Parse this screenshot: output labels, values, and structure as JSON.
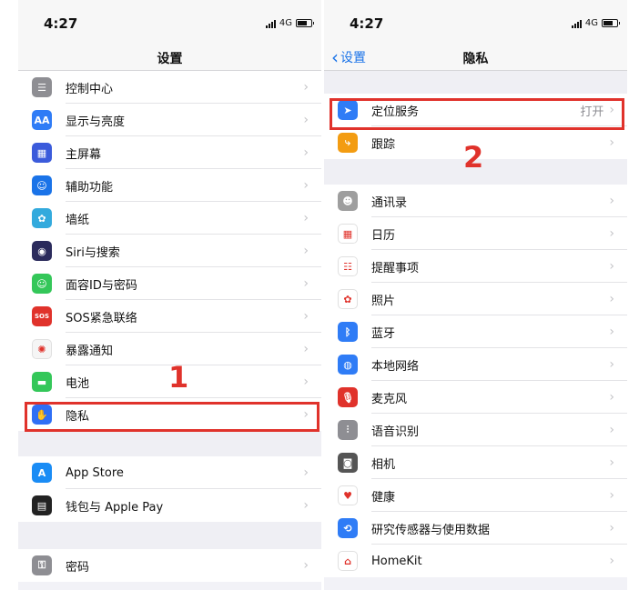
{
  "left": {
    "time": "4:27",
    "network": "4G",
    "title": "设置",
    "group1": [
      {
        "label": "控制中心",
        "icon": "switches-icon",
        "color": "#8e8e93",
        "glyph": "☰"
      },
      {
        "label": "显示与亮度",
        "icon": "display-aa-icon",
        "color": "#2f7cf6",
        "glyph": "AA"
      },
      {
        "label": "主屏幕",
        "icon": "home-screen-icon",
        "color": "#3b5bdb",
        "glyph": "▦"
      },
      {
        "label": "辅助功能",
        "icon": "accessibility-icon",
        "color": "#1a73e8",
        "glyph": "☺"
      },
      {
        "label": "墙纸",
        "icon": "wallpaper-flower-icon",
        "color": "#33aadd",
        "glyph": "✿"
      },
      {
        "label": "Siri与搜索",
        "icon": "siri-icon",
        "color": "#2b2b5c",
        "glyph": "◉"
      },
      {
        "label": "面容ID与密码",
        "icon": "face-id-icon",
        "color": "#34c759",
        "glyph": "☺"
      },
      {
        "label": "SOS紧急联络",
        "icon": "sos-icon",
        "color": "#e0322b",
        "glyph": "SOS"
      },
      {
        "label": "暴露通知",
        "icon": "exposure-notification-icon",
        "color": "#f5f5f5",
        "glyph": "✺"
      },
      {
        "label": "电池",
        "icon": "battery-icon",
        "color": "#34c759",
        "glyph": "▬"
      },
      {
        "label": "隐私",
        "icon": "privacy-hand-icon",
        "color": "#2f6ff5",
        "glyph": "✋"
      }
    ],
    "group2": [
      {
        "label": "App Store",
        "icon": "app-store-icon",
        "color": "#1a8cf5",
        "glyph": "A"
      },
      {
        "label": "钱包与 Apple Pay",
        "icon": "wallet-icon",
        "color": "#222222",
        "glyph": "▤"
      }
    ],
    "group3": [
      {
        "label": "密码",
        "icon": "key-icon",
        "color": "#8e8e93",
        "glyph": "⚿"
      }
    ],
    "step": "1"
  },
  "right": {
    "time": "4:27",
    "network": "4G",
    "back": "设置",
    "title": "隐私",
    "group1": [
      {
        "label": "定位服务",
        "icon": "location-arrow-icon",
        "color": "#2f7cf6",
        "glyph": "➤",
        "value": "打开"
      },
      {
        "label": "跟踪",
        "icon": "tracking-icon",
        "color": "#f39c12",
        "glyph": "⤷",
        "value": ""
      }
    ],
    "group2": [
      {
        "label": "通讯录",
        "icon": "contacts-icon",
        "color": "#9e9e9e",
        "glyph": "☻"
      },
      {
        "label": "日历",
        "icon": "calendar-icon",
        "color": "#ffffff",
        "glyph": "▦"
      },
      {
        "label": "提醒事项",
        "icon": "reminders-icon",
        "color": "#ffffff",
        "glyph": "☷"
      },
      {
        "label": "照片",
        "icon": "photos-icon",
        "color": "#ffffff",
        "glyph": "✿"
      },
      {
        "label": "蓝牙",
        "icon": "bluetooth-icon",
        "color": "#2f7cf6",
        "glyph": "ᛒ"
      },
      {
        "label": "本地网络",
        "icon": "local-network-globe-icon",
        "color": "#2f7cf6",
        "glyph": "◍"
      },
      {
        "label": "麦克风",
        "icon": "microphone-icon",
        "color": "#e0322b",
        "glyph": "🎙"
      },
      {
        "label": "语音识别",
        "icon": "speech-recognition-icon",
        "color": "#8e8e93",
        "glyph": "⫶"
      },
      {
        "label": "相机",
        "icon": "camera-icon",
        "color": "#555555",
        "glyph": "◙"
      },
      {
        "label": "健康",
        "icon": "health-heart-icon",
        "color": "#ffffff",
        "glyph": "♥"
      },
      {
        "label": "研究传感器与使用数据",
        "icon": "research-sensor-icon",
        "color": "#2f7cf6",
        "glyph": "⟲"
      },
      {
        "label": "HomeKit",
        "icon": "homekit-house-icon",
        "color": "#ffffff",
        "glyph": "⌂"
      }
    ],
    "step": "2"
  }
}
